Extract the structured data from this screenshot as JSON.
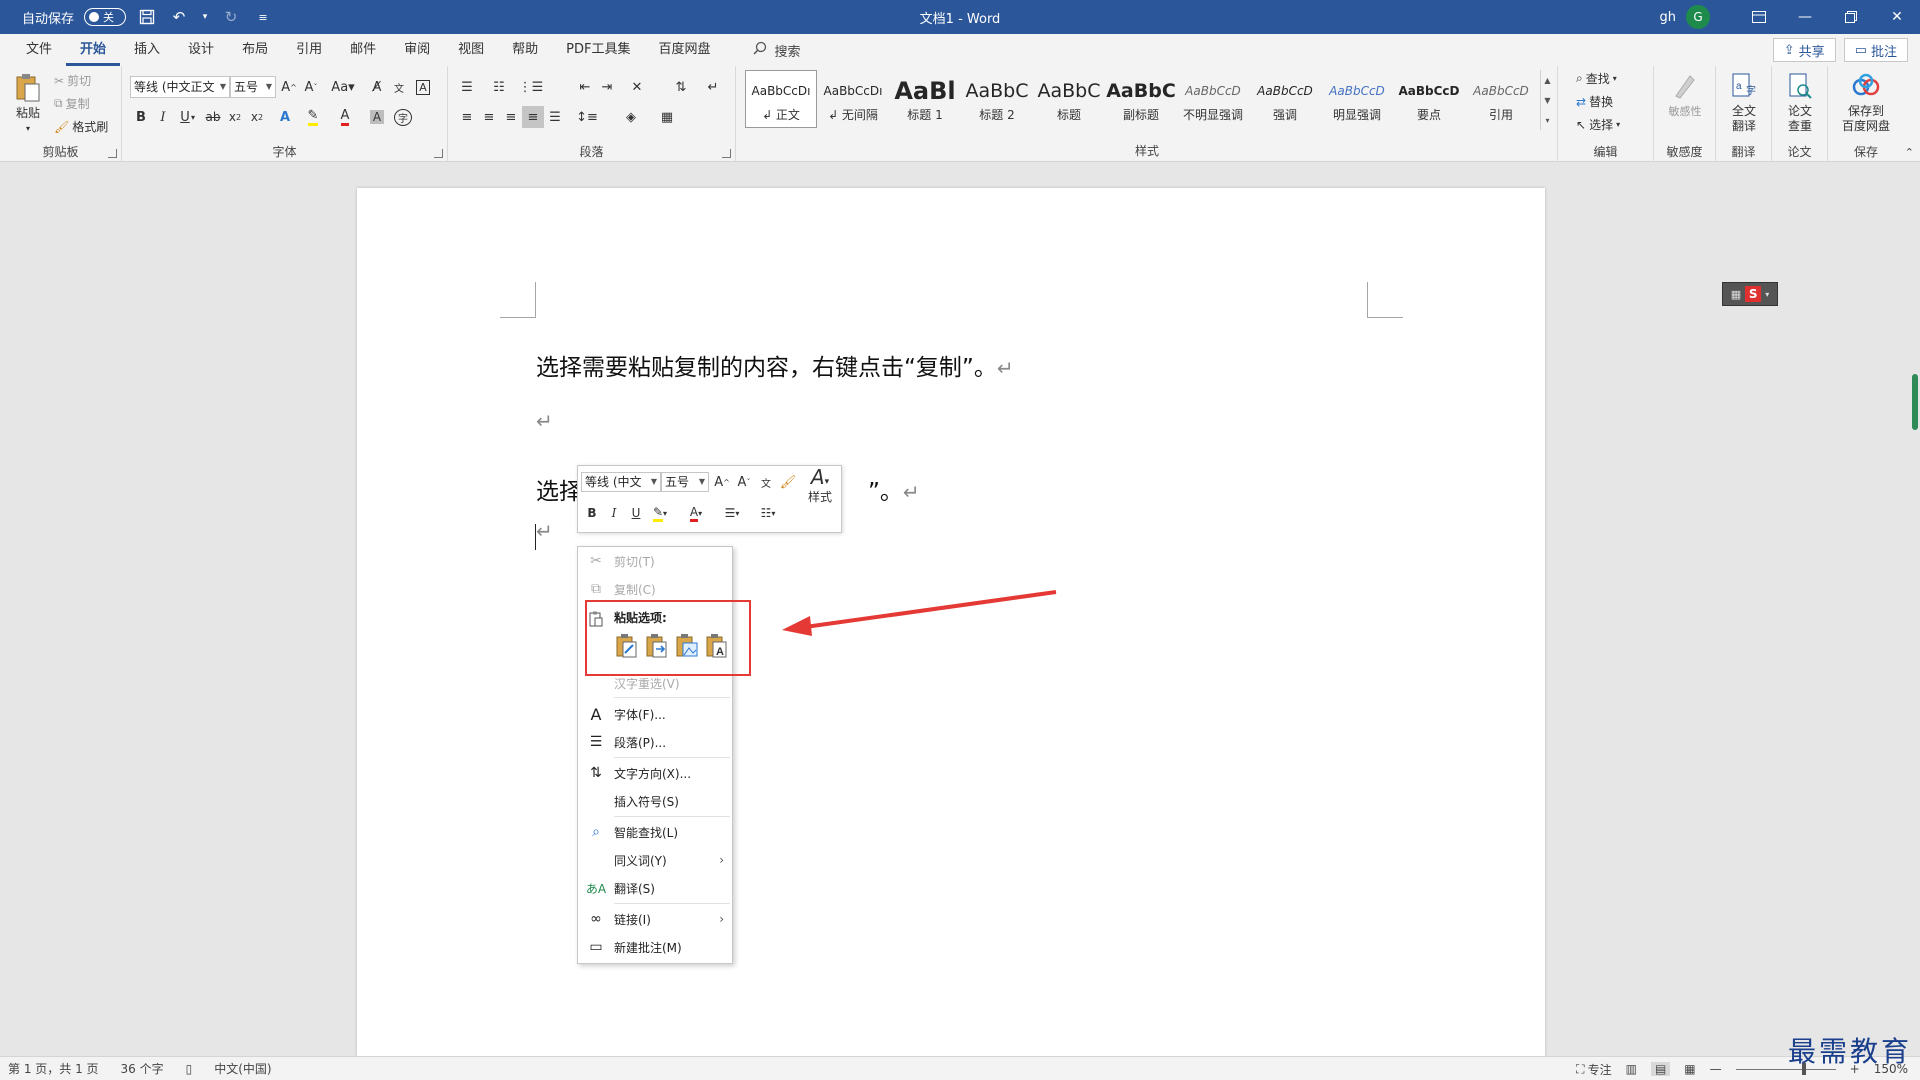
{
  "titlebar": {
    "autosave_label": "自动保存",
    "autosave_state": "关",
    "doc_title": "文档1  -  Word",
    "user_name": "gh",
    "avatar_letter": "G"
  },
  "tabs": [
    "文件",
    "开始",
    "插入",
    "设计",
    "布局",
    "引用",
    "邮件",
    "审阅",
    "视图",
    "帮助",
    "PDF工具集",
    "百度网盘"
  ],
  "active_tab": "开始",
  "search_label": "搜索",
  "share_label": "共享",
  "comment_label": "批注",
  "ribbon": {
    "clipboard": {
      "paste": "粘贴",
      "cut": "剪切",
      "copy": "复制",
      "format_painter": "格式刷",
      "label": "剪贴板"
    },
    "font": {
      "font_name": "等线 (中文正文",
      "font_size": "五号",
      "label": "字体"
    },
    "paragraph": {
      "label": "段落"
    },
    "styles": {
      "label": "样式",
      "items": [
        {
          "sample": "AaBbCcDı",
          "name": "↲ 正文"
        },
        {
          "sample": "AaBbCcDı",
          "name": "↲ 无间隔"
        },
        {
          "sample": "AaBl",
          "name": "标题 1"
        },
        {
          "sample": "AaBbC",
          "name": "标题 2"
        },
        {
          "sample": "AaBbC",
          "name": "标题"
        },
        {
          "sample": "AaBbC",
          "name": "副标题"
        },
        {
          "sample": "AaBbCcD",
          "name": "不明显强调"
        },
        {
          "sample": "AaBbCcD",
          "name": "强调"
        },
        {
          "sample": "AaBbCcD",
          "name": "明显强调"
        },
        {
          "sample": "AaBbCcD",
          "name": "要点"
        },
        {
          "sample": "AaBbCcD",
          "name": "引用"
        }
      ]
    },
    "editing": {
      "find": "查找",
      "replace": "替换",
      "select": "选择",
      "label": "编辑"
    },
    "sensitivity": {
      "button": "敏感性",
      "label": "敏感度"
    },
    "translate": {
      "button_line1": "全文",
      "button_line2": "翻译",
      "label": "翻译"
    },
    "paper": {
      "button_line1": "论文",
      "button_line2": "查重",
      "label": "论文"
    },
    "save": {
      "button_line1": "保存到",
      "button_line2": "百度网盘",
      "label": "保存"
    }
  },
  "document": {
    "line1": "选择需要粘贴复制的内容，右键点击“复制”。",
    "line3_start": "选择",
    "line3_end": "”。",
    "paragraph_mark": "↵"
  },
  "mini_toolbar": {
    "font_name": "等线 (中文",
    "font_size": "五号",
    "styles_label": "样式"
  },
  "context_menu": {
    "cut": "剪切(T)",
    "copy": "复制(C)",
    "paste_options": "粘贴选项:",
    "hanzi": "汉字重选(V)",
    "font": "字体(F)...",
    "paragraph": "段落(P)...",
    "text_direction": "文字方向(X)...",
    "insert_symbol": "插入符号(S)",
    "smart_lookup": "智能查找(L)",
    "synonyms": "同义词(Y)",
    "translate": "翻译(S)",
    "link": "链接(I)",
    "new_comment": "新建批注(M)"
  },
  "statusbar": {
    "page": "第 1 页，共 1 页",
    "words": "36 个字",
    "language": "中文(中国)",
    "focus": "专注",
    "zoom": "150%"
  },
  "watermark": "最需教育",
  "colors": {
    "accent": "#2b579a",
    "highlight_box": "#e53935",
    "arrow": "#e53935"
  }
}
